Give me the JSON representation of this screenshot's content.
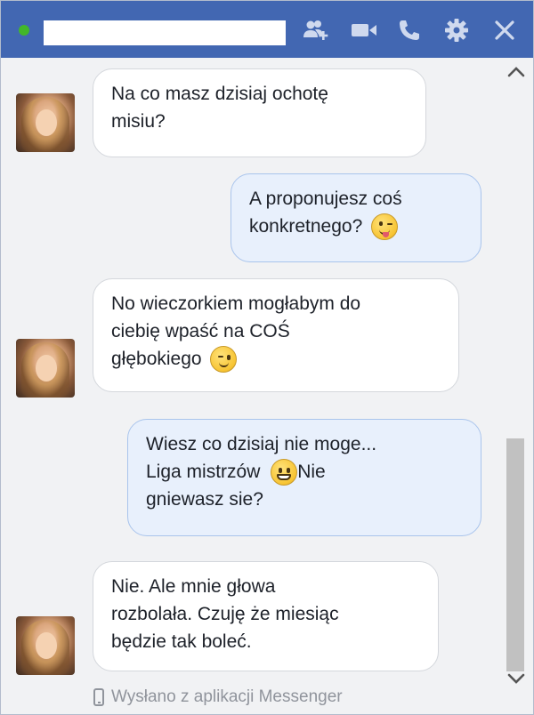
{
  "header": {
    "status": "online",
    "icons": [
      "add-friend-icon",
      "video-call-icon",
      "phone-call-icon",
      "settings-icon",
      "close-icon"
    ],
    "color": "#4267b2"
  },
  "messages": [
    {
      "direction": "incoming",
      "lines": [
        "Na co masz dzisiaj ochotę",
        "misiu?"
      ]
    },
    {
      "direction": "outgoing",
      "lines": [
        "A proponujesz coś",
        "konkretnego?"
      ],
      "emoji": "tongue-wink-emoji"
    },
    {
      "direction": "incoming",
      "lines": [
        "No wieczorkiem mogłabym do",
        "ciebię wpaść na COŚ",
        "głębokiego"
      ],
      "emoji": "wink-emoji"
    },
    {
      "direction": "outgoing",
      "lines": [
        "Wiesz co dzisiaj nie moge...",
        "Liga mistrzów",
        "Nie",
        "gniewasz sie?"
      ],
      "emoji": "grin-emoji"
    },
    {
      "direction": "incoming",
      "lines": [
        "Nie. Ale mnie głowa",
        "rozbolała. Czuję że miesiąc",
        "będzie tak boleć."
      ]
    }
  ],
  "footer": {
    "sent_via": "Wysłano z aplikacji Messenger"
  },
  "colors": {
    "incoming_bubble": "#ffffff",
    "outgoing_bubble": "#e8f0fc",
    "outgoing_border": "#a9c4ec"
  }
}
